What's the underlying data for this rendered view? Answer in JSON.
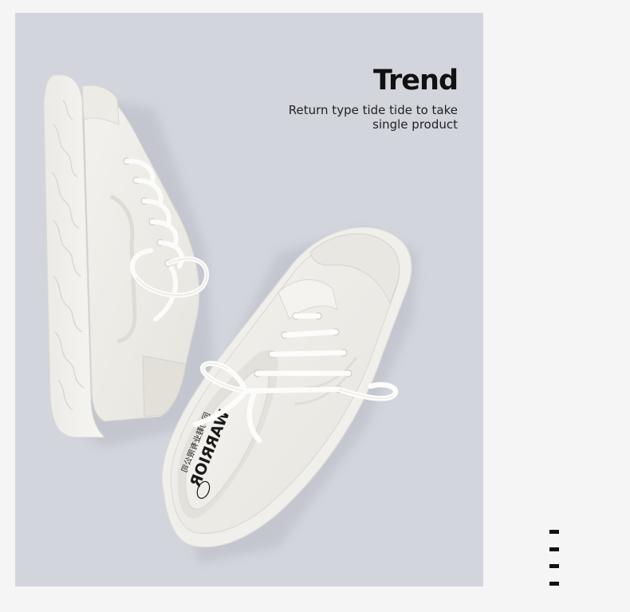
{
  "photo": {
    "background_color": "#d3d5dd",
    "subject": "white-canvas-sneakers",
    "insole_print": {
      "brand": "WARRIOR",
      "chinese_text": "回力鞋业有限公司"
    }
  },
  "caption": {
    "title": "Trend",
    "subtitle_line1": "Return type tide tide to take",
    "subtitle_line2": "single product"
  },
  "decoration": {
    "dash_count": 4,
    "color": "#111111"
  }
}
